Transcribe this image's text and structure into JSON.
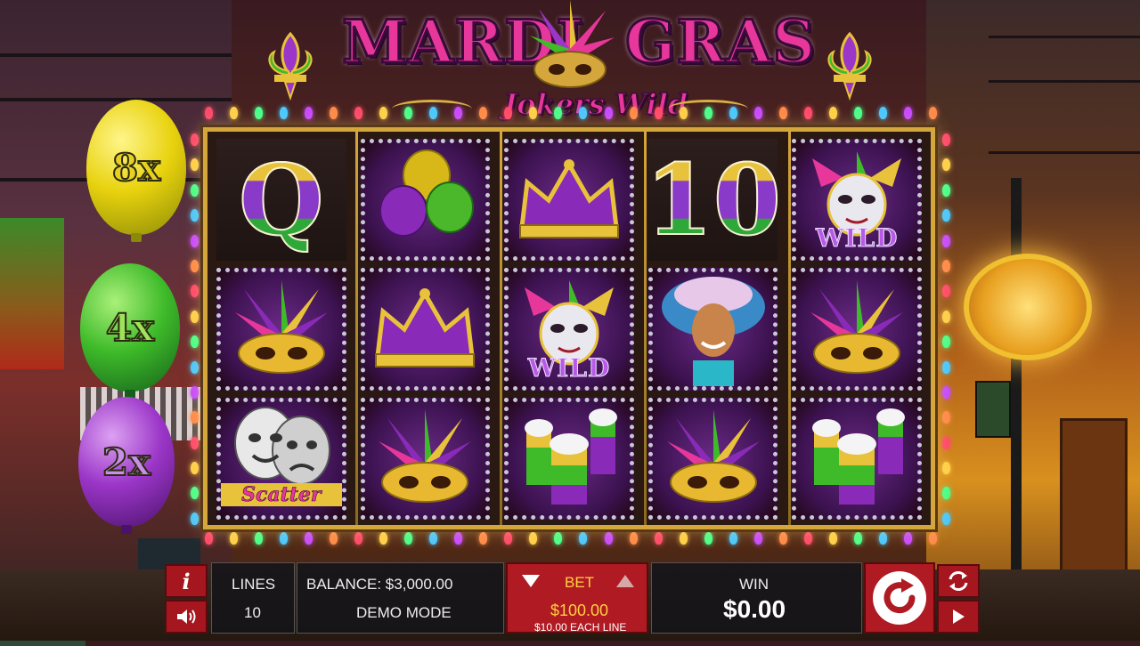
{
  "logo": {
    "title_left": "MARDI",
    "title_right": "GRAS",
    "subtitle": "Jokers Wild"
  },
  "multipliers": [
    {
      "label": "8x",
      "color": "#e8d20e"
    },
    {
      "label": "4x",
      "color": "#3fbb2a"
    },
    {
      "label": "2x",
      "color": "#9b36c8"
    }
  ],
  "reels": [
    [
      "Q",
      "balloons",
      "crown",
      "10",
      "jester-wild"
    ],
    [
      "mask",
      "crown",
      "jester-wild",
      "dancer",
      "mask"
    ],
    [
      "scatter",
      "mask",
      "drinks",
      "mask",
      "drinks"
    ]
  ],
  "symbols": {
    "wild_label": "WILD",
    "scatter_label": "Scatter",
    "q": "Q",
    "ten": "10"
  },
  "console": {
    "info_label": "i",
    "lines_label": "LINES",
    "lines_value": "10",
    "balance_label": "BALANCE: $3,000.00",
    "mode_label": "DEMO MODE",
    "bet_label": "BET",
    "bet_value": "$100.00",
    "bet_each": "$10.00 EACH LINE",
    "win_label": "WIN",
    "win_value": "$0.00"
  },
  "colors": {
    "accent_red": "#b01a22",
    "gold": "#d4a63c",
    "pink": "#e8379a",
    "purple": "#9b36c8"
  }
}
